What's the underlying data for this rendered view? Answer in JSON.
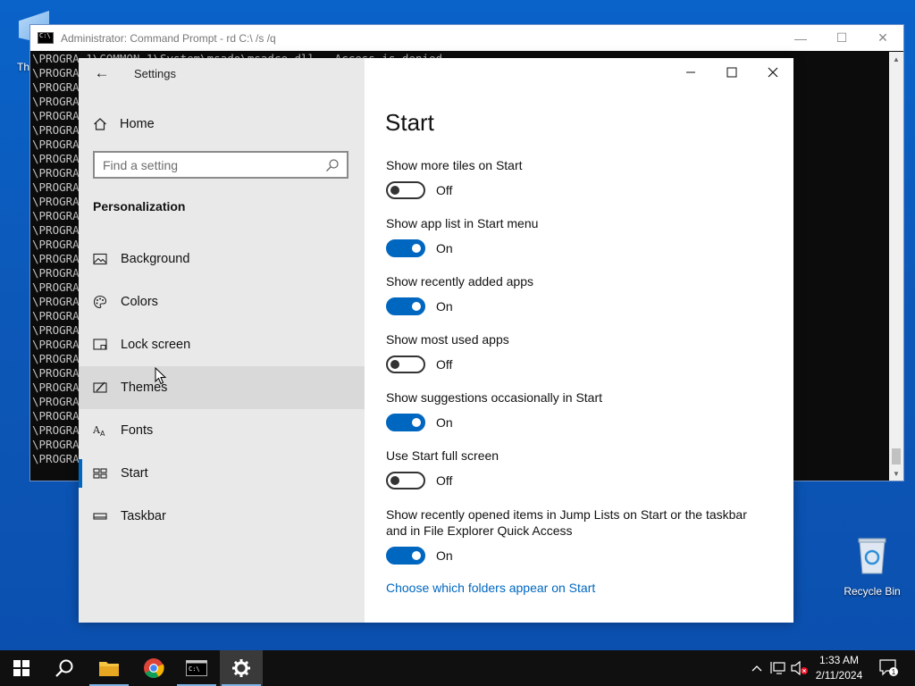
{
  "desktop": {
    "partial_icon_label": "Th",
    "recycle_bin_label": "Recycle Bin"
  },
  "cmd": {
    "title": "Administrator: Command Prompt - rd  C:\\ /s /q",
    "lines": [
      "\\PROGRA~1\\COMMON~1\\System\\msado\\msadce.dll - Access is denied.",
      "\\PROGRA",
      "\\PROGRA",
      "\\PROGRA",
      "\\PROGRA",
      "\\PROGRA",
      "\\PROGRA",
      "\\PROGRA",
      "\\PROGRA",
      "\\PROGRA",
      "\\PROGRA",
      "\\PROGRA",
      "\\PROGRA",
      "\\PROGRA",
      "\\PROGRA",
      "\\PROGRA",
      "\\PROGRA",
      "\\PROGRA",
      "\\PROGRA",
      "\\PROGRA",
      "\\PROGRA",
      "\\PROGRA",
      "\\PROGRA",
      "\\PROGRA",
      "\\PROGRA",
      "\\PROGRA",
      "\\PROGRA",
      "\\PROGRA",
      "\\PROGRA"
    ]
  },
  "settings": {
    "app_title": "Settings",
    "home_label": "Home",
    "search_placeholder": "Find a setting",
    "section_title": "Personalization",
    "nav": [
      {
        "label": "Background",
        "icon": "picture-icon"
      },
      {
        "label": "Colors",
        "icon": "palette-icon"
      },
      {
        "label": "Lock screen",
        "icon": "lock-screen-icon"
      },
      {
        "label": "Themes",
        "icon": "brush-icon"
      },
      {
        "label": "Fonts",
        "icon": "fonts-icon"
      },
      {
        "label": "Start",
        "icon": "start-tiles-icon"
      },
      {
        "label": "Taskbar",
        "icon": "taskbar-icon"
      }
    ],
    "hovered_item": "Themes",
    "active_item": "Start",
    "page_title": "Start",
    "options": [
      {
        "label": "Show more tiles on Start",
        "state": "Off",
        "on": false
      },
      {
        "label": "Show app list in Start menu",
        "state": "On",
        "on": true
      },
      {
        "label": "Show recently added apps",
        "state": "On",
        "on": true
      },
      {
        "label": "Show most used apps",
        "state": "Off",
        "on": false
      },
      {
        "label": "Show suggestions occasionally in Start",
        "state": "On",
        "on": true
      },
      {
        "label": "Use Start full screen",
        "state": "Off",
        "on": false
      },
      {
        "label": "Show recently opened items in Jump Lists on Start or the taskbar and in File Explorer Quick Access",
        "state": "On",
        "on": true
      }
    ],
    "link_text": "Choose which folders appear on Start",
    "accent_color": "#0067c0"
  },
  "taskbar": {
    "time": "1:33 AM",
    "date": "2/11/2024",
    "notification_count": "1"
  }
}
